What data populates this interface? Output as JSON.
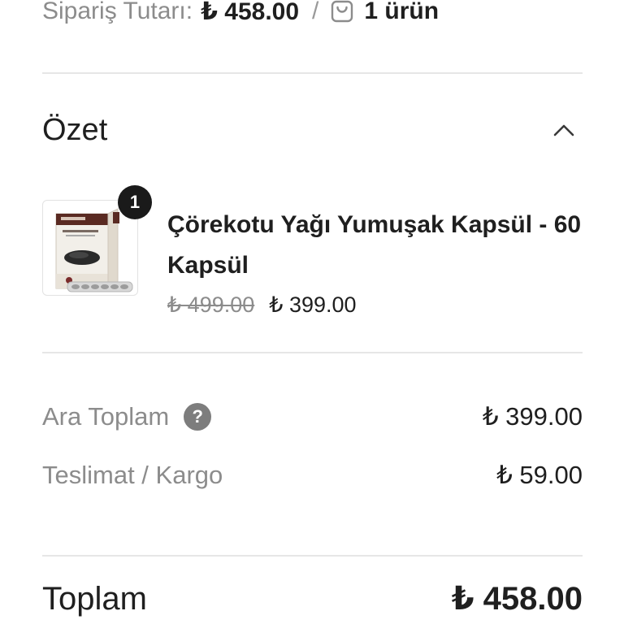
{
  "order_summary": {
    "label": "Sipariş Tutarı:",
    "amount": "₺ 458.00",
    "separator": "/",
    "item_count": "1 ürün"
  },
  "summary_section": {
    "title": "Özet",
    "expanded": true
  },
  "product": {
    "quantity": "1",
    "name": "Çörekotu Yağı Yumuşak Kapsül - 60 Kapsül",
    "old_price": "₺ 499.00",
    "price": "₺ 399.00"
  },
  "totals": {
    "subtotal_label": "Ara Toplam",
    "subtotal_value": "₺ 399.00",
    "help_glyph": "?",
    "shipping_label": "Teslimat / Kargo",
    "shipping_value": "₺ 59.00",
    "total_label": "Toplam",
    "total_value": "₺ 458.00"
  },
  "colors": {
    "muted_text": "#8c8c8c",
    "primary_text": "#1f1f1f",
    "divider": "#e6e6e6",
    "badge": "#1a1a1a",
    "help_icon": "#7d7d7d"
  }
}
